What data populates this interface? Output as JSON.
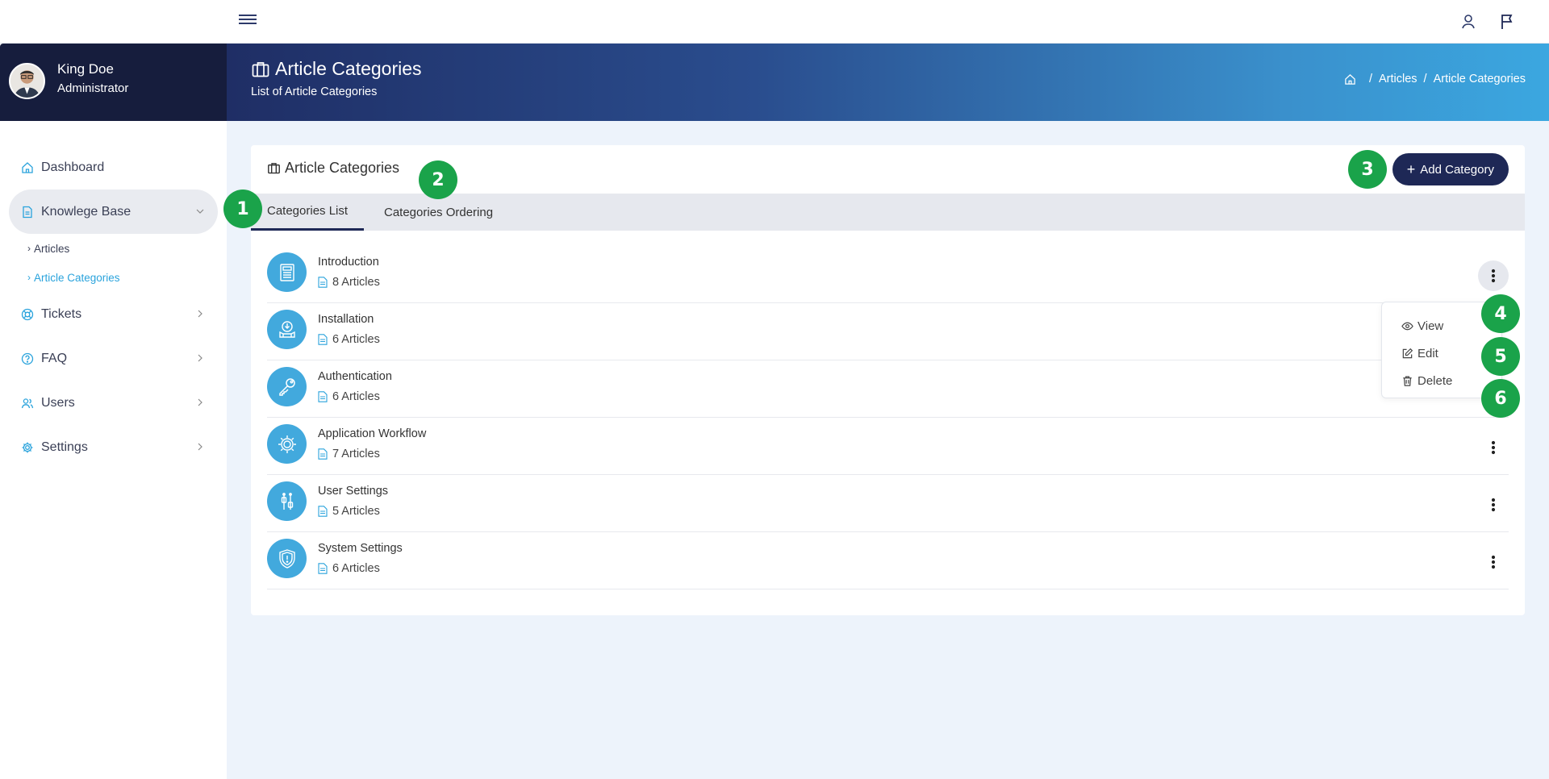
{
  "sidebar": {
    "profile": {
      "name": "King Doe",
      "role": "Administrator"
    },
    "menu": [
      {
        "label": "Dashboard",
        "icon": "home-icon"
      },
      {
        "label": "Knowlege Base",
        "icon": "document-icon",
        "expanded": true,
        "children": [
          {
            "label": "Articles"
          },
          {
            "label": "Article Categories",
            "current": true
          }
        ]
      },
      {
        "label": "Tickets",
        "icon": "lifebuoy-icon"
      },
      {
        "label": "FAQ",
        "icon": "question-circle-icon"
      },
      {
        "label": "Users",
        "icon": "users-icon"
      },
      {
        "label": "Settings",
        "icon": "gear-icon"
      }
    ]
  },
  "header": {
    "title": "Article Categories",
    "subtitle": "List of Article Categories",
    "breadcrumb": [
      "Articles",
      "Article Categories"
    ]
  },
  "card": {
    "title": "Article Categories",
    "add_button": "Add Category",
    "tabs": [
      {
        "label": "Categories List",
        "active": true
      },
      {
        "label": "Categories Ordering"
      }
    ],
    "categories": [
      {
        "name": "Introduction",
        "count": "8 Articles",
        "icon": "newspaper-icon"
      },
      {
        "name": "Installation",
        "count": "6 Articles",
        "icon": "install-icon"
      },
      {
        "name": "Authentication",
        "count": "6 Articles",
        "icon": "key-icon"
      },
      {
        "name": "Application Workflow",
        "count": "7 Articles",
        "icon": "workflow-gear-icon"
      },
      {
        "name": "User Settings",
        "count": "5 Articles",
        "icon": "sliders-icon"
      },
      {
        "name": "System Settings",
        "count": "6 Articles",
        "icon": "shield-icon"
      }
    ],
    "dropdown": [
      {
        "label": "View",
        "icon": "eye-icon"
      },
      {
        "label": "Edit",
        "icon": "edit-icon"
      },
      {
        "label": "Delete",
        "icon": "trash-icon"
      }
    ]
  },
  "markers": [
    "1",
    "2",
    "3",
    "4",
    "5",
    "6"
  ],
  "colors": {
    "accent": "#42a9dd",
    "navy": "#1e2856",
    "marker": "#1aa34a",
    "page_bg": "#edf3fb"
  }
}
